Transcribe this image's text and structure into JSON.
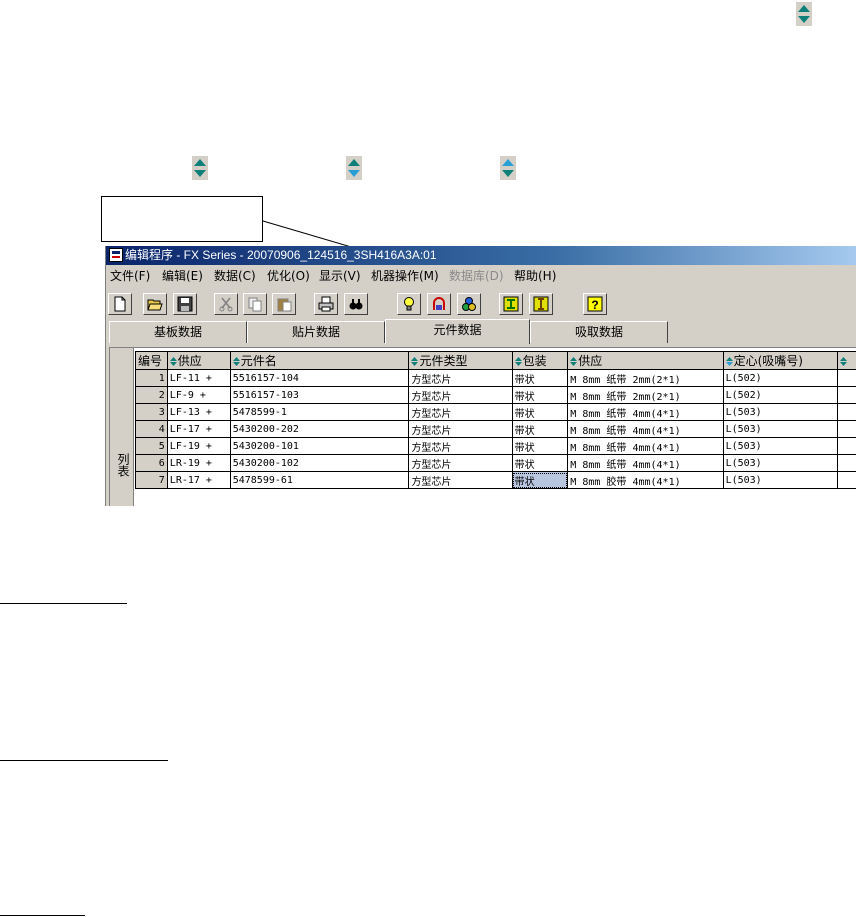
{
  "window": {
    "title": "编辑程序 - FX Series - 20070906_124516_3SH416A3A:01"
  },
  "menu": [
    "文件(F)",
    "编辑(E)",
    "数据(C)",
    "优化(O)",
    "显示(V)",
    "机器操作(M)",
    "数据库(D)",
    "帮助(H)"
  ],
  "menu_disabled_index": 6,
  "toolbar": {
    "icons": [
      "new-file-icon",
      "open-folder-icon",
      "save-icon",
      "cut-icon",
      "copy-icon",
      "paste-icon",
      "print-icon",
      "find-icon",
      "light-bulb-icon",
      "nozzle-icon",
      "parts-icon",
      "optimize-icon",
      "info-icon",
      "help-icon"
    ],
    "help_glyph": "?"
  },
  "tabs": [
    "基板数据",
    "贴片数据",
    "元件数据",
    "吸取数据"
  ],
  "active_tab": 2,
  "grid": {
    "side_label": "列表",
    "headers": [
      "编号",
      "供应",
      "元件名",
      "元件类型",
      "包装",
      "供应",
      "定心(吸嘴号)"
    ],
    "rows": [
      [
        "1",
        "LF-11 +",
        "5516157-104",
        "方型芯片",
        "带状",
        "M 8mm 纸带 2mm(2*1)",
        "L(502)"
      ],
      [
        "2",
        "LF-9 +",
        "5516157-103",
        "方型芯片",
        "带状",
        "M 8mm 纸带 2mm(2*1)",
        "L(502)"
      ],
      [
        "3",
        "LF-13 +",
        "5478599-1",
        "方型芯片",
        "带状",
        "M 8mm 纸带 4mm(4*1)",
        "L(503)"
      ],
      [
        "4",
        "LF-17 +",
        "5430200-202",
        "方型芯片",
        "带状",
        "M 8mm 纸带 4mm(4*1)",
        "L(503)"
      ],
      [
        "5",
        "LF-19 +",
        "5430200-101",
        "方型芯片",
        "带状",
        "M 8mm 纸带 4mm(4*1)",
        "L(503)"
      ],
      [
        "6",
        "LR-19 +",
        "5430200-102",
        "方型芯片",
        "带状",
        "M 8mm 纸带 4mm(4*1)",
        "L(503)"
      ],
      [
        "7",
        "LR-17 +",
        "5478599-61",
        "方型芯片",
        "带状",
        "M 8mm 胶带 4mm(4*1)",
        "L(503)"
      ]
    ]
  },
  "colors": {
    "sort_icon_top": "#0f7f7a",
    "sort_icon_bottom": "#0f7f7a",
    "selection": "#b9c6e0",
    "title_bar": "#0a246a"
  }
}
